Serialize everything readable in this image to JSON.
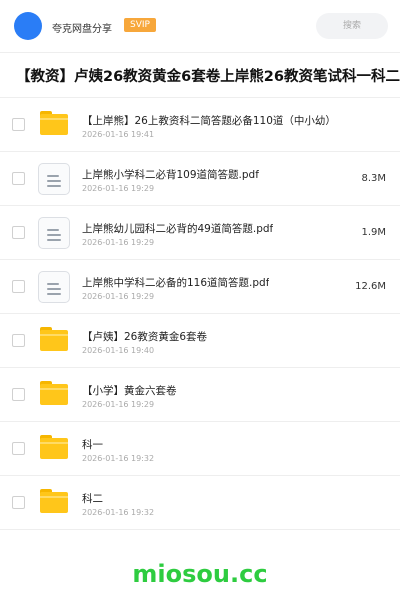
{
  "header": {
    "app_name": "夸克网盘分享",
    "badge": "SVIP",
    "search_placeholder": "搜索",
    "avatar_color": "#2a7df6"
  },
  "title": "【教资】卢姨26教资黄金6套卷上岸熊26教资笔试科一科二",
  "files": [
    {
      "type": "folder",
      "icon": "folder-icon",
      "name": "【上岸熊】26上教资科二简答题必备110道（中小幼）",
      "date": "2026-01-16 19:41",
      "size": ""
    },
    {
      "type": "file",
      "icon": "document-icon",
      "name": "上岸熊小学科二必背109道简答题.pdf",
      "date": "2026-01-16 19:29",
      "size": "8.3M"
    },
    {
      "type": "file",
      "icon": "document-icon",
      "name": "上岸熊幼儿园科二必背的49道简答题.pdf",
      "date": "2026-01-16 19:29",
      "size": "1.9M"
    },
    {
      "type": "file",
      "icon": "document-icon",
      "name": "上岸熊中学科二必备的116道简答题.pdf",
      "date": "2026-01-16 19:29",
      "size": "12.6M"
    },
    {
      "type": "folder",
      "icon": "folder-icon",
      "name": "【卢姨】26教资黄金6套卷",
      "date": "2026-01-16 19:40",
      "size": ""
    },
    {
      "type": "folder",
      "icon": "folder-icon",
      "name": "【小学】黄金六套卷",
      "date": "2026-01-16 19:29",
      "size": ""
    },
    {
      "type": "folder",
      "icon": "folder-icon",
      "name": "科一",
      "date": "2026-01-16 19:32",
      "size": ""
    },
    {
      "type": "folder",
      "icon": "folder-icon",
      "name": "科二",
      "date": "2026-01-16 19:32",
      "size": ""
    }
  ],
  "watermark": "miosou.cc",
  "colors": {
    "badge": "#f7a73b",
    "folder": "#ffc61a",
    "watermark": "#2ecc40"
  }
}
